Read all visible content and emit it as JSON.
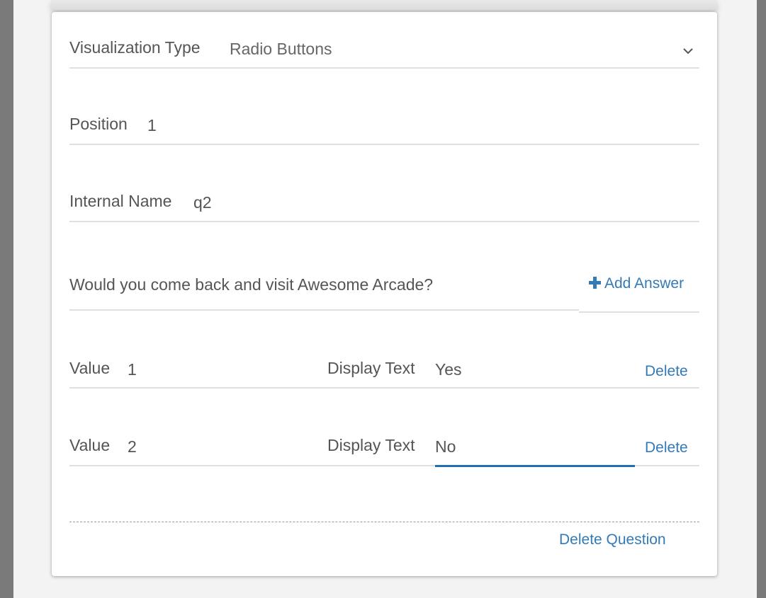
{
  "form": {
    "visualization_type": {
      "label": "Visualization Type",
      "value": "Radio Buttons"
    },
    "position": {
      "label": "Position",
      "value": "1"
    },
    "internal_name": {
      "label": "Internal Name",
      "value": "q2"
    },
    "question": {
      "text": "Would you come back and visit Awesome Arcade?",
      "add_answer_label": "Add Answer"
    },
    "answers": [
      {
        "value_label": "Value",
        "value": "1",
        "display_label": "Display Text",
        "display_value": "Yes",
        "delete_label": "Delete"
      },
      {
        "value_label": "Value",
        "value": "2",
        "display_label": "Display Text",
        "display_value": "No",
        "delete_label": "Delete"
      }
    ],
    "delete_question_label": "Delete Question"
  },
  "colors": {
    "accent": "#337ab7",
    "active_underline": "#1f6fb0",
    "text": "#555555",
    "divider": "#e0e0e0"
  },
  "icons": {
    "dropdown": "chevron-down-icon",
    "add": "plus-icon"
  }
}
